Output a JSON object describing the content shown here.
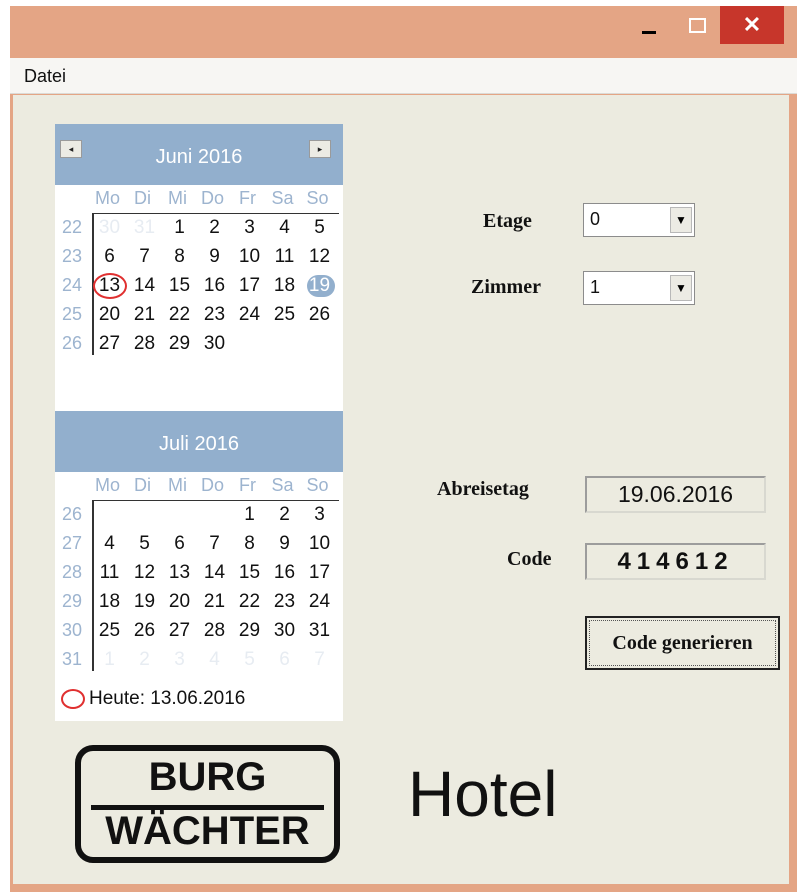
{
  "window": {
    "controls": {
      "minimize": "minimize",
      "maximize": "maximize",
      "close": "✕"
    }
  },
  "menu": {
    "file": "Datei"
  },
  "calendar": {
    "weekday_labels": [
      "Mo",
      "Di",
      "Mi",
      "Do",
      "Fr",
      "Sa",
      "So"
    ],
    "months": [
      {
        "title": "Juni 2016",
        "show_nav": true,
        "prev_glyph": "◂",
        "next_glyph": "▸",
        "weeks": [
          {
            "num": "22",
            "days": [
              "30",
              "31",
              "1",
              "2",
              "3",
              "4",
              "5"
            ],
            "dim": [
              0,
              1
            ]
          },
          {
            "num": "23",
            "days": [
              "6",
              "7",
              "8",
              "9",
              "10",
              "11",
              "12"
            ],
            "dim": []
          },
          {
            "num": "24",
            "days": [
              "13",
              "14",
              "15",
              "16",
              "17",
              "18",
              "19"
            ],
            "dim": []
          },
          {
            "num": "25",
            "days": [
              "20",
              "21",
              "22",
              "23",
              "24",
              "25",
              "26"
            ],
            "dim": []
          },
          {
            "num": "26",
            "days": [
              "27",
              "28",
              "29",
              "30",
              "",
              "",
              ""
            ],
            "dim": []
          }
        ],
        "today": {
          "week": 2,
          "day": 0
        },
        "selected": {
          "week": 2,
          "day": 6
        }
      },
      {
        "title": "Juli 2016",
        "show_nav": false,
        "weeks": [
          {
            "num": "26",
            "days": [
              "",
              "",
              "",
              "",
              "1",
              "2",
              "3"
            ],
            "dim": []
          },
          {
            "num": "27",
            "days": [
              "4",
              "5",
              "6",
              "7",
              "8",
              "9",
              "10"
            ],
            "dim": []
          },
          {
            "num": "28",
            "days": [
              "11",
              "12",
              "13",
              "14",
              "15",
              "16",
              "17"
            ],
            "dim": []
          },
          {
            "num": "29",
            "days": [
              "18",
              "19",
              "20",
              "21",
              "22",
              "23",
              "24"
            ],
            "dim": []
          },
          {
            "num": "30",
            "days": [
              "25",
              "26",
              "27",
              "28",
              "29",
              "30",
              "31"
            ],
            "dim": []
          },
          {
            "num": "31",
            "days": [
              "1",
              "2",
              "3",
              "4",
              "5",
              "6",
              "7"
            ],
            "dim": [
              0,
              1,
              2,
              3,
              4,
              5,
              6
            ]
          }
        ]
      }
    ],
    "today_text": "Heute: 13.06.2016"
  },
  "form": {
    "etage_label": "Etage",
    "etage_value": "0",
    "zimmer_label": "Zimmer",
    "zimmer_value": "1",
    "abreise_label": "Abreisetag",
    "abreise_value": "19.06.2016",
    "code_label": "Code",
    "code_value": "414612",
    "generate_button": "Code generieren"
  },
  "branding": {
    "logo_line1": "BURG",
    "logo_line2": "WÄCHTER",
    "product": "Hotel"
  },
  "colors": {
    "titlebar": "#e4a585",
    "close_button": "#c7362b",
    "calendar_header": "#92afcd",
    "today_marker": "#e03030"
  }
}
